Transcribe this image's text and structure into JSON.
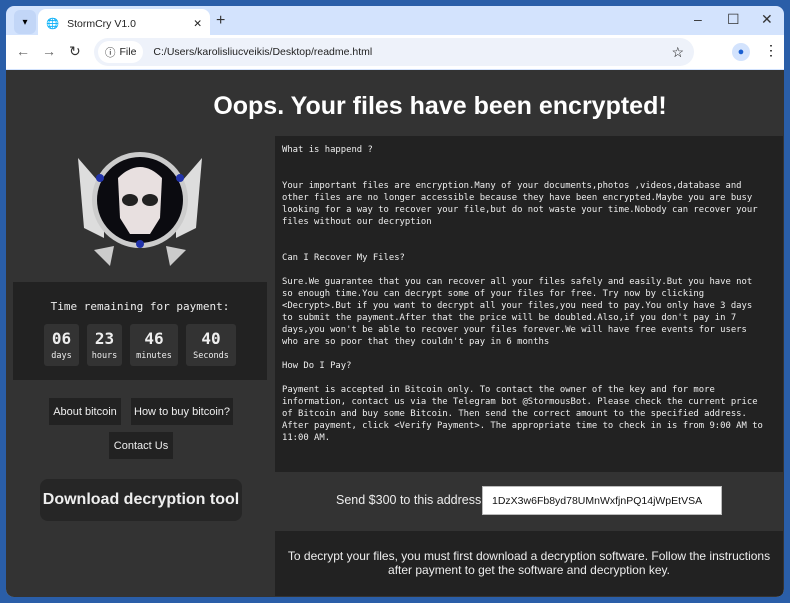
{
  "browser": {
    "tab_title": "StormCry V1.0",
    "url_chip": "File",
    "url": "C:/Users/karolisliucveikis/Desktop/readme.html"
  },
  "page": {
    "heading": "Oops. Your files have been encrypted!",
    "note": "What is happend ?\n\n\nYour important files are encryption.Many of your documents,photos ,videos,database and\nother files are no longer accessible because they have been encrypted.Maybe you are busy\nlooking for a way to recover your file,but do not waste your time.Nobody can recover your\nfiles without our decryption\n\n\nCan I Recover My Files?\n\nSure.We guarantee that you can recover all your files safely and easily.But you have not\nso enough time.You can decrypt some of your files for free. Try now by clicking\n<Decrypt>.But if you want to decrypt all your files,you need to pay.You only have 3 days\nto submit the payment.After that the price will be doubled.Also,if you don't pay in 7\ndays,you won't be able to recover your files forever.We will have free events for users\nwho are so poor that they couldn't pay in 6 months\n\nHow Do I Pay?\n\nPayment is accepted in Bitcoin only. To contact the owner of the key and for more\ninformation, contact us via the Telegram bot @StormousBot. Please check the current price\nof Bitcoin and buy some Bitcoin. Then send the correct amount to the specified address.\nAfter payment, click <Verify Payment>. The appropriate time to check in is from 9:00 AM to\n11:00 AM.",
    "timer": {
      "label": "Time remaining for payment:",
      "days": "06",
      "days_label": "days",
      "hours": "23",
      "hours_label": "hours",
      "minutes": "46",
      "minutes_label": "minutes",
      "seconds": "40",
      "seconds_label": "Seconds"
    },
    "buttons": {
      "about": "About bitcoin",
      "how": "How to buy bitcoin?",
      "contact": "Contact Us",
      "download": "Download decryption tool"
    },
    "send_label": "Send $300 to this address:",
    "address": "1DzX3w6Fb8yd78UMnWxfjnPQ14jWpEtVSA",
    "bottom": "To decrypt your files, you must first download a decryption software. Follow the instructions after payment to get the software and decryption key."
  }
}
